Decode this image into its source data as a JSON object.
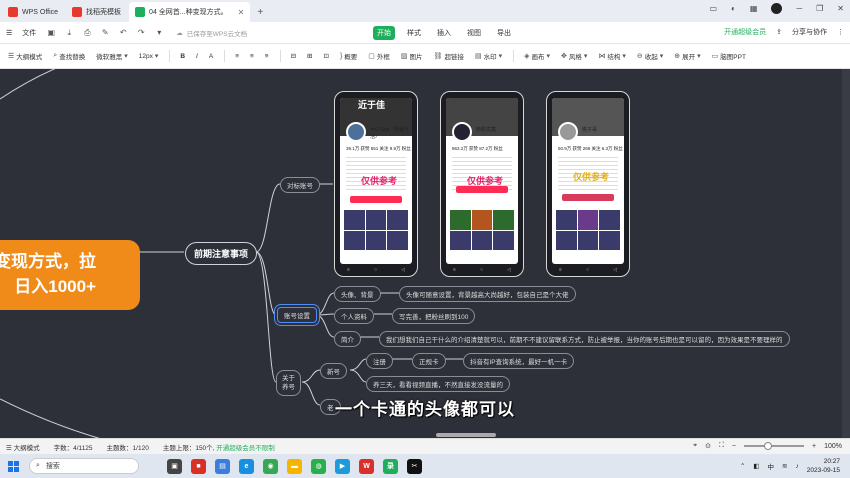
{
  "tabs": [
    {
      "label": "WPS Office",
      "color": "#e8392f"
    },
    {
      "label": "找稻壳模板",
      "color": "#e8392f"
    },
    {
      "label": "04 全网首...种变现方式。",
      "color": "#1fae5b"
    }
  ],
  "titlebar": {
    "new_tab": "+"
  },
  "menu": {
    "file": "文件",
    "save_hint": "已保存至WPS云文档",
    "tabs": [
      "开始",
      "样式",
      "插入",
      "视图",
      "导出"
    ],
    "upgrade": "开通超级会员",
    "share": "分享与协作"
  },
  "toolbar": {
    "outline": "大纲模式",
    "find": "查找替换",
    "font": "微软雅黑",
    "size": "12px",
    "bold": "B",
    "italic": "I",
    "color": "A",
    "items": [
      "概要",
      "外框",
      "图片",
      "超链接",
      "水印",
      "画布",
      "风格",
      "结构",
      "收起",
      "展开",
      "脑图PPT"
    ]
  },
  "mindmap": {
    "root": "变现方式，拉\n日入1000+",
    "main_node": "前期注意事项",
    "branch_benchmark": "对标账号",
    "branch_account": "账号设置",
    "branch_about": "关于\n养号",
    "leaf_avatar": "头像、背景",
    "leaf_avatar_desc": "头像可随意设置，背景越高大尚越好，包装自己是个大佬",
    "leaf_profile": "个人资料",
    "leaf_profile_desc": "写完善，把粉丝刷到100",
    "leaf_intro": "简介",
    "leaf_intro_desc": "我们想我们自己干什么的介绍清楚就可以，前期不不建议留联系方式，防止被举报，当你的账号后期也是可以留的，因为效果是不要理样的",
    "leaf_new": "新号",
    "leaf_register": "注册",
    "leaf_sim": "正规卡",
    "leaf_sim_desc": "抖音有IP查询系统，最好一机一卡",
    "leaf_raise": "养三天，看看视频直播，不然直接发没流量的",
    "leaf_old": "老"
  },
  "phones": [
    {
      "name": "近于佳",
      "handle": "大C Gup（我豪干活）",
      "stats": "39.1万 获赞   551 关注   9.9万 粉丝",
      "watermark": "仅供参考"
    },
    {
      "name": "随机文案",
      "handle": "",
      "stats": "863.2万 获赞   87.2万 粉丝",
      "watermark": "仅供参考"
    },
    {
      "name": "桃子哥",
      "handle": "",
      "stats": "50.9万 获赞   266 关注   6.3万 粉丝",
      "watermark": "仅供参考"
    }
  ],
  "subtitle": "一个卡通的头像都可以",
  "status": {
    "outline": "大纲模式",
    "chars": "字数：4/1125",
    "topics": "主题数：1/120",
    "limit": "主题上限：150个,",
    "upgrade_link": "开通超级会员不限制",
    "zoom": "100%"
  },
  "taskbar": {
    "search": "搜索",
    "time": "20:27",
    "date": "2023-09-15"
  },
  "colors": {
    "accent": "#1fae5b",
    "root_node": "#f08a18",
    "canvas": "#2e3039",
    "watermark": "#e0246b"
  }
}
